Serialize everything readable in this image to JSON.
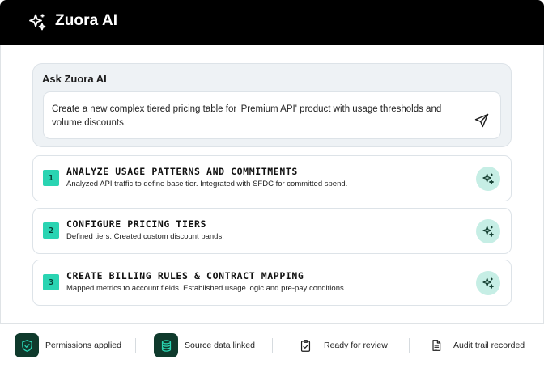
{
  "app": {
    "title": "Zuora AI",
    "logo_icon": "sparkles-icon"
  },
  "ask": {
    "title": "Ask Zuora AI",
    "prompt": "Create a new complex tiered pricing table for 'Premium API' product with usage thresholds and volume discounts.",
    "send_icon": "send-icon"
  },
  "steps": [
    {
      "number": "1",
      "title": "ANALYZE USAGE PATTERNS AND COMMITMENTS",
      "description": "Analyzed API traffic to define base tier. Integrated with SFDC for committed spend.",
      "icon": "sparkles-icon"
    },
    {
      "number": "2",
      "title": "CONFIGURE PRICING TIERS",
      "description": "Defined tiers. Created custom discount bands.",
      "icon": "sparkles-icon"
    },
    {
      "number": "3",
      "title": "CREATE BILLING RULES & CONTRACT MAPPING",
      "description": "Mapped metrics to account fields. Established usage logic and pre-pay conditions.",
      "icon": "sparkles-icon"
    }
  ],
  "footer": {
    "items": [
      {
        "label": "Permissions applied",
        "icon": "shield-check-icon"
      },
      {
        "label": "Source data linked",
        "icon": "database-icon"
      },
      {
        "label": "Ready for review",
        "icon": "clipboard-check-icon"
      },
      {
        "label": "Audit trail recorded",
        "icon": "document-icon"
      }
    ]
  },
  "colors": {
    "header_bg": "#000000",
    "accent": "#2ad4b2",
    "accent_soft": "#c6eee5",
    "badge_dark": "#0f3a2c",
    "panel_bg": "#eef2f5"
  }
}
